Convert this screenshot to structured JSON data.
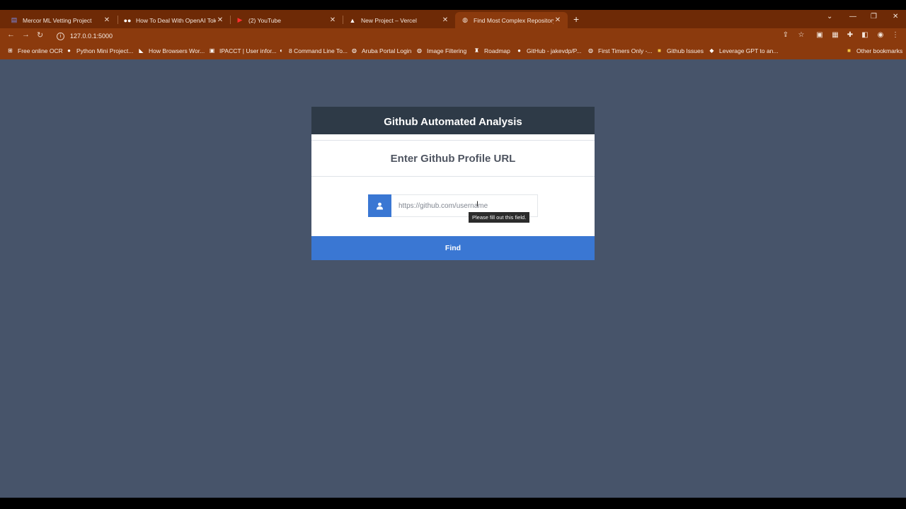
{
  "browser": {
    "tabs": [
      {
        "label": "Mercor ML Vetting Project",
        "icon": "sheets-icon",
        "color": "#7c8ef0"
      },
      {
        "label": "How To Deal With OpenAI Token",
        "icon": "medium-icon",
        "color": "#ffffff"
      },
      {
        "label": "(2) YouTube",
        "icon": "youtube-icon",
        "color": "#ff2d2d"
      },
      {
        "label": "New Project – Vercel",
        "icon": "vercel-icon",
        "color": "#ffffff"
      },
      {
        "label": "Find Most Complex Repository",
        "icon": "globe-icon",
        "color": "#f3e6dc",
        "active": true
      }
    ],
    "address": "127.0.0.1:5000",
    "bookmarks": [
      {
        "label": "Free online OCR",
        "icon": "grid-icon"
      },
      {
        "label": "Python Mini Project...",
        "icon": "github-icon"
      },
      {
        "label": "How Browsers Wor...",
        "icon": "bookmark-icon"
      },
      {
        "label": "IPACCT | User infor...",
        "icon": "bookmark-icon"
      },
      {
        "label": "8 Command Line To...",
        "icon": "bookmark-icon"
      },
      {
        "label": "Aruba Portal Login",
        "icon": "globe-icon"
      },
      {
        "label": "Image Filtering",
        "icon": "globe-icon"
      },
      {
        "label": "Roadmap",
        "icon": "bookmark-icon"
      },
      {
        "label": "GitHub - jakevdp/P...",
        "icon": "github-icon"
      },
      {
        "label": "First Timers Only -...",
        "icon": "globe-icon"
      },
      {
        "label": "Github Issues",
        "icon": "folder-icon"
      },
      {
        "label": "Leverage GPT to an...",
        "icon": "bookmark-icon"
      }
    ],
    "other_bookmarks": "Other bookmarks"
  },
  "page": {
    "title": "Github Automated Analysis",
    "subtitle": "Enter Github Profile URL",
    "input_placeholder": "https://github.com/username",
    "tooltip": "Please fill out this field.",
    "button_label": "Find"
  },
  "colors": {
    "accent": "#3a77d3",
    "header": "#2e3a47",
    "background": "#47546a",
    "browser_frame": "#8b3a0d"
  }
}
